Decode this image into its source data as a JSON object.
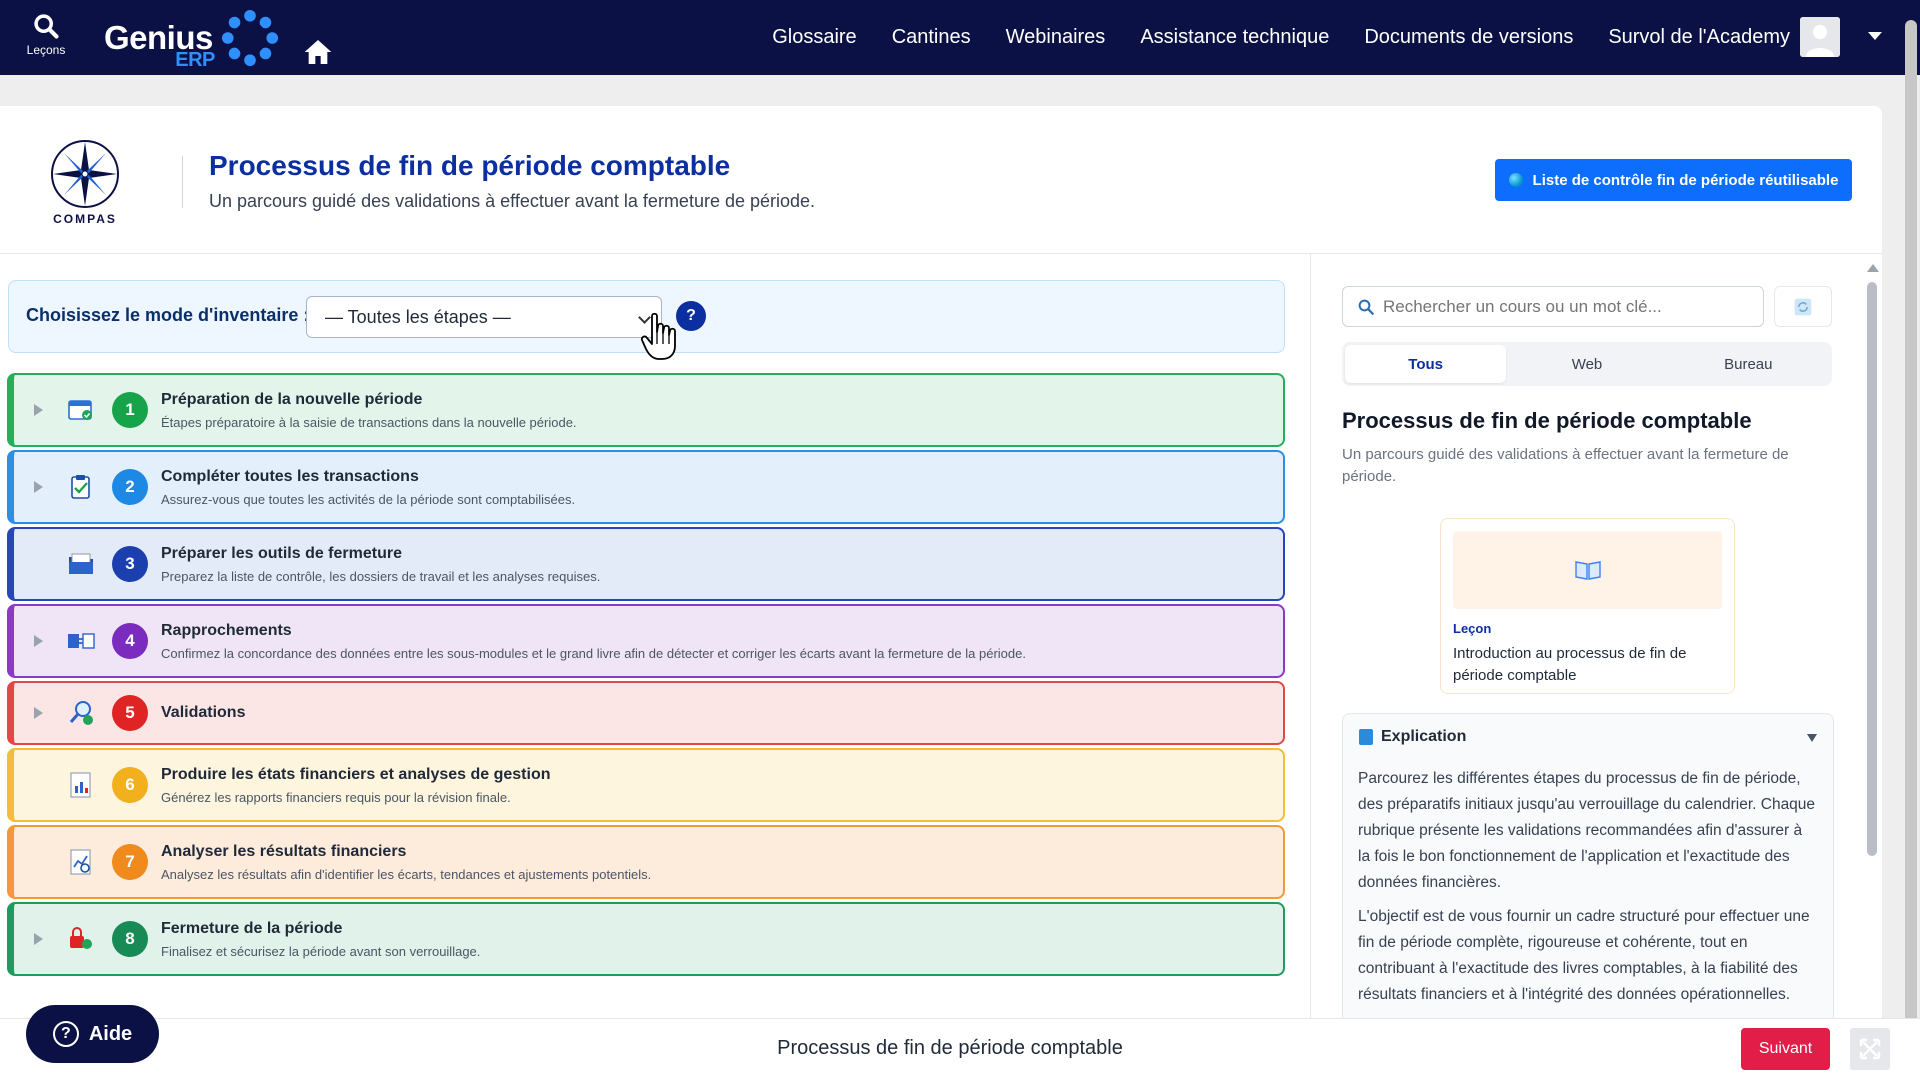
{
  "topbar": {
    "search_label": "Leçons",
    "brand_name": "Genius",
    "brand_suffix": "ERP",
    "nav": [
      "Glossaire",
      "Cantines",
      "Webinaires",
      "Assistance technique",
      "Documents de versions",
      "Survol de l'Academy"
    ]
  },
  "header": {
    "logo_word": "COMPAS",
    "title": "Processus de fin de période comptable",
    "subtitle": "Un parcours guidé des validations à effectuer avant la fermeture de période.",
    "checklist_label": "Liste de contrôle fin de période réutilisable"
  },
  "mode": {
    "label": "Choisissez le mode d'inventaire :",
    "selected": "— Toutes les étapes —",
    "help": "?"
  },
  "steps": [
    {
      "n": "1",
      "title": "Préparation de la nouvelle période",
      "desc": "Étapes préparatoire à la saisie de transactions dans la nouvelle période.",
      "color": "#17a34a",
      "bg": "#e3f5ea",
      "border": "#22b15a",
      "expandable": true,
      "icon": "calendar-check-icon"
    },
    {
      "n": "2",
      "title": "Compléter toutes les transactions",
      "desc": "Assurez-vous que toutes les activités de la période sont comptabilisées.",
      "color": "#1e88e5",
      "bg": "#e3effb",
      "border": "#2b8fe6",
      "expandable": true,
      "icon": "clipboard-check-icon"
    },
    {
      "n": "3",
      "title": "Préparer les outils de fermeture",
      "desc": "Preparez la liste de contrôle, les dossiers de travail et les analyses requises.",
      "color": "#1c3fb0",
      "bg": "#e4ebf8",
      "border": "#2746b8",
      "expandable": false,
      "icon": "folder-icon"
    },
    {
      "n": "4",
      "title": "Rapprochements",
      "desc": "Confirmez la concordance des données entre les sous-modules et le grand livre afin de détecter et corriger les écarts avant la fermeture de la période.",
      "color": "#7b2cbf",
      "bg": "#efe5f6",
      "border": "#8a3ac7",
      "expandable": true,
      "icon": "reconcile-icon"
    },
    {
      "n": "5",
      "title": "Validations",
      "desc": "",
      "color": "#e02424",
      "bg": "#fbe5e5",
      "border": "#e34848",
      "expandable": true,
      "icon": "magnifier-check-icon"
    },
    {
      "n": "6",
      "title": "Produire les états financiers et analyses de gestion",
      "desc": "Générez les rapports financiers requis pour la révision finale.",
      "color": "#f2b01e",
      "bg": "#fdf5de",
      "border": "#f3be3a",
      "expandable": false,
      "icon": "report-chart-icon"
    },
    {
      "n": "7",
      "title": "Analyser les résultats financiers",
      "desc": "Analysez les résultats afin d'identifier les écarts, tendances et ajustements potentiels.",
      "color": "#f08a1c",
      "bg": "#fdebdb",
      "border": "#f29a3a",
      "expandable": false,
      "icon": "analysis-chart-icon"
    },
    {
      "n": "8",
      "title": "Fermeture de la période",
      "desc": "Finalisez et sécurisez la période avant son verrouillage.",
      "color": "#178a55",
      "bg": "#e1f2ea",
      "border": "#1f9a60",
      "expandable": true,
      "icon": "lock-close-icon"
    }
  ],
  "right": {
    "search_placeholder": "Rechercher un cours ou un mot clé...",
    "tabs": [
      "Tous",
      "Web",
      "Bureau"
    ],
    "title": "Processus de fin de période comptable",
    "subtitle": "Un parcours guidé des validations à effectuer avant la fermeture de période.",
    "lesson_tag": "Leçon",
    "lesson_title": "Introduction au processus de fin de période comptable",
    "expl_title": "Explication",
    "expl_p1": "Parcourez les différentes étapes du processus de fin de période, des préparatifs initiaux jusqu'au verrouillage du calendrier. Chaque rubrique présente les validations recommandées afin d'assurer à la fois le bon fonctionnement de l'application et l'exactitude des données financières.",
    "expl_p2": "L'objectif est de vous fournir un cadre structuré pour effectuer une fin de période complète, rigoureuse et cohérente, tout en contribuant à l'exactitude des livres comptables, à la fiabilité des résultats financiers et à l'intégrité des données opérationnelles."
  },
  "bottom": {
    "help_label": "Aide",
    "title": "Processus de fin de période comptable",
    "next_label": "Suivant"
  }
}
